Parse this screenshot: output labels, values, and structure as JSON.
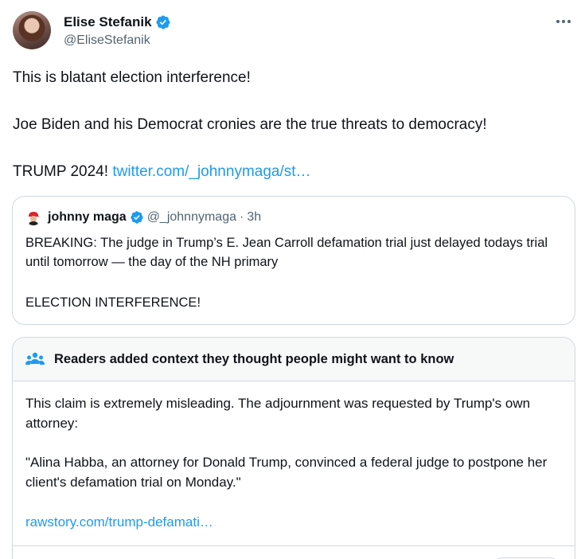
{
  "tweet": {
    "author_name": "Elise Stefanik",
    "author_handle": "@EliseStefanik",
    "line1": "This is blatant election interference!",
    "line2": "Joe Biden and his Democrat cronies are the true threats to democracy!",
    "line3_text": "TRUMP 2024! ",
    "line3_link": "twitter.com/_johnnymaga/st…"
  },
  "quote": {
    "author_name": "johnny maga",
    "author_handle": "@_johnnymaga",
    "separator": "·",
    "time": "3h",
    "text1": "BREAKING: The judge in Trump’s E. Jean Carroll defamation trial just delayed todays trial until tomorrow — the day of the NH primary",
    "text2": "ELECTION INTERFERENCE!"
  },
  "community_note": {
    "title": "Readers added context they thought people might want to know",
    "text1": "This claim is extremely misleading. The adjournment was requested by Trump's own attorney:",
    "text2": "\"Alina Habba, an attorney for Donald Trump, convinced a federal judge to postpone her client's defamation trial on Monday.\"",
    "link": "rawstory.com/trump-defamati…"
  },
  "colors": {
    "link": "#1d9bf0",
    "verified": "#1d9bf0",
    "muted_text": "#536471",
    "border": "#cfd9de"
  },
  "icons": {
    "verified": "verified-badge-icon",
    "more": "more-options-icon",
    "note": "people-icon"
  }
}
